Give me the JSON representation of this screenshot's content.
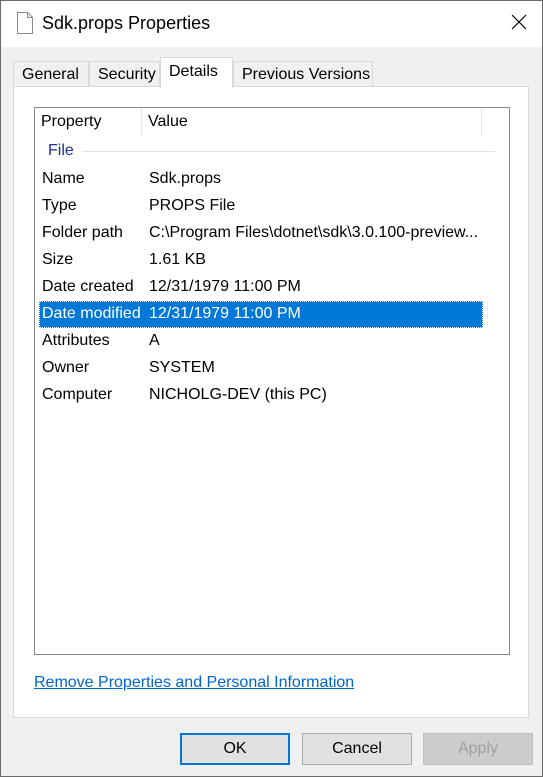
{
  "window": {
    "title": "Sdk.props Properties",
    "icon": "document-icon",
    "close_icon": "close-icon"
  },
  "tabs": [
    {
      "label": "General",
      "active": false
    },
    {
      "label": "Security",
      "active": false
    },
    {
      "label": "Details",
      "active": true
    },
    {
      "label": "Previous Versions",
      "active": false
    }
  ],
  "details": {
    "columns": {
      "property": "Property",
      "value": "Value"
    },
    "group": "File",
    "rows": [
      {
        "property": "Name",
        "value": "Sdk.props"
      },
      {
        "property": "Type",
        "value": "PROPS File"
      },
      {
        "property": "Folder path",
        "value": "C:\\Program Files\\dotnet\\sdk\\3.0.100-preview..."
      },
      {
        "property": "Size",
        "value": "1.61 KB"
      },
      {
        "property": "Date created",
        "value": "12/31/1979 11:00 PM"
      },
      {
        "property": "Date modified",
        "value": "12/31/1979 11:00 PM"
      },
      {
        "property": "Attributes",
        "value": "A"
      },
      {
        "property": "Owner",
        "value": "SYSTEM"
      },
      {
        "property": "Computer",
        "value": "NICHOLG-DEV (this PC)"
      }
    ],
    "selected_row": 5
  },
  "remove_link": "Remove Properties and Personal Information",
  "buttons": {
    "ok": "OK",
    "cancel": "Cancel",
    "apply": "Apply"
  },
  "colors": {
    "selection": "#0078d7",
    "link": "#0066cc",
    "group_label": "#1e3287"
  }
}
